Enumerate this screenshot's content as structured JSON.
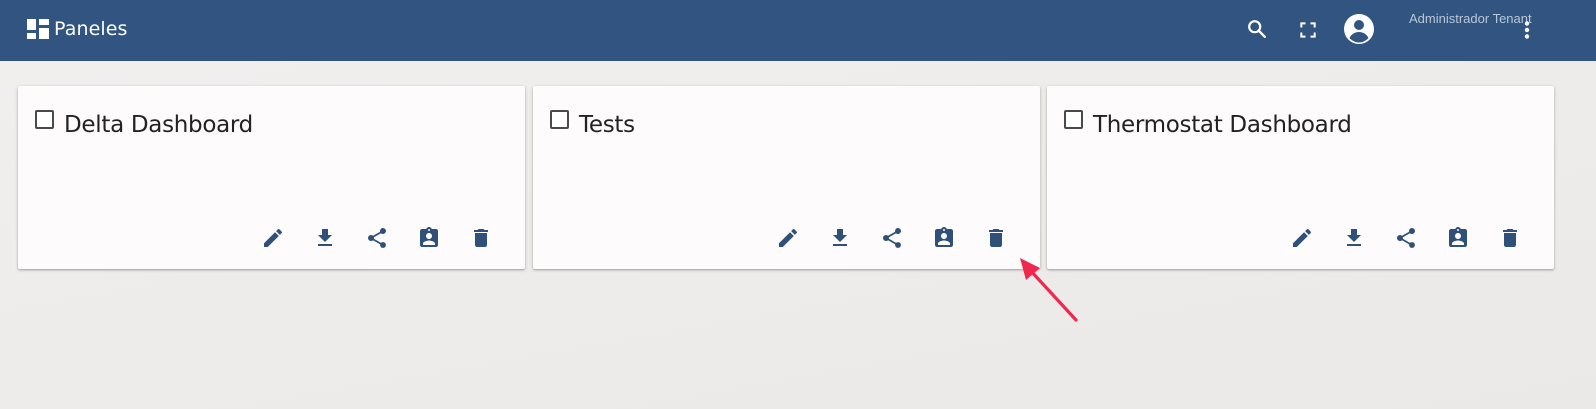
{
  "header": {
    "title": "Paneles",
    "app_icon": "dashboard-icon",
    "user_name": "Administrador Tenant",
    "search_icon": "search-icon",
    "fullscreen_icon": "fullscreen-icon",
    "avatar_icon": "account-circle-icon",
    "menu_icon": "more-vert-icon"
  },
  "dashboards": [
    {
      "title": "Delta Dashboard"
    },
    {
      "title": "Tests"
    },
    {
      "title": "Thermostat Dashboard"
    }
  ],
  "card_actions": [
    "edit-icon",
    "download-icon",
    "share-icon",
    "assign-customer-icon",
    "delete-icon"
  ],
  "colors": {
    "header_bg": "#315580",
    "icon": "#2f5078",
    "annotation_arrow": "#f0284f",
    "page_bg": "#eeeceb"
  }
}
